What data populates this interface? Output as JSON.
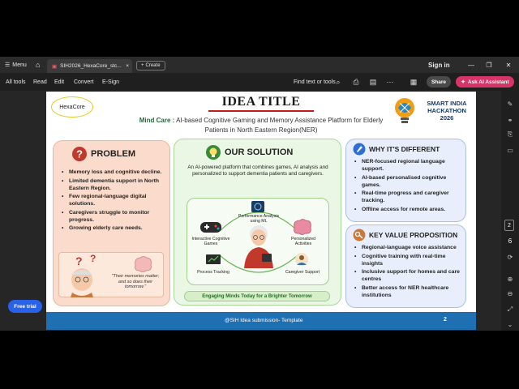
{
  "browser": {
    "menu_label": "Menu",
    "tab_title": "SIH2026_HexaCore_stc...",
    "create_label": "Create",
    "sign_in": "Sign in"
  },
  "toolbar": {
    "items": [
      "All tools",
      "Read",
      "Edit",
      "Convert",
      "E-Sign"
    ],
    "find_label": "Find text or tools",
    "share_label": "Share",
    "ai_label": "Ask AI Assistant"
  },
  "rail": {
    "page_current": "2",
    "page_total": "6"
  },
  "free_trial": "Free trial",
  "slide": {
    "team_name": "HexaCore",
    "idea_title": "IDEA TITLE",
    "subtitle_lead": "Mind Care :",
    "subtitle_rest": " AI-based Cognitive Gaming and Memory Assistance Platform for Elderly Patients in North Eastern Region(NER)",
    "logo_text": [
      "SMART INDIA",
      "HACKATHON",
      "2026"
    ],
    "problem": {
      "title": "PROBLEM",
      "items": [
        "Memory loss and cognitive decline.",
        "Limited dementia support in North Eastern Region.",
        "Few regional-language digital solutions.",
        "Caregivers struggle to monitor progress.",
        "Growing elderly care needs."
      ],
      "quote": "\"Their memories matter; and so does their tomorrow.\""
    },
    "solution": {
      "title": "OUR SOLUTION",
      "desc": "An AI-powered platform that combines games, AI analysis and personalized to support dementia patients and caregivers.",
      "nodes": {
        "top": "Performance Analysis using ML",
        "left": "Interactive Cognitive Games",
        "right": "Personalized Activities",
        "bottom_left": "Process Tracking",
        "bottom_right": "Caregiver Support"
      },
      "banner": "Engaging Minds Today for a Brighter Tomorrow"
    },
    "different": {
      "title": "WHY IT'S DIFFERENT",
      "items": [
        "NER-focused regional language support.",
        "AI-based personalised cognitive games.",
        "Real-time progress and caregiver tracking.",
        "Offline access for remote areas."
      ]
    },
    "value": {
      "title": "KEY VALUE PROPOSITION",
      "items": [
        "Regional-language voice assistance",
        "Cognitive training with real-time insights",
        "Inclusive support for homes and care centres",
        "Better access for NER healthcare institutions"
      ]
    },
    "footer_text": "@SIH Idea submission- Template",
    "footer_page": "2"
  },
  "colors": {
    "accent_red": "#c01c1c",
    "ai_pink": "#d9346a",
    "footer_blue": "#1f6fb3",
    "problem_bg": "#fbdccc",
    "solution_bg": "#eaf7e4",
    "info_bg": "#e8eefb"
  }
}
